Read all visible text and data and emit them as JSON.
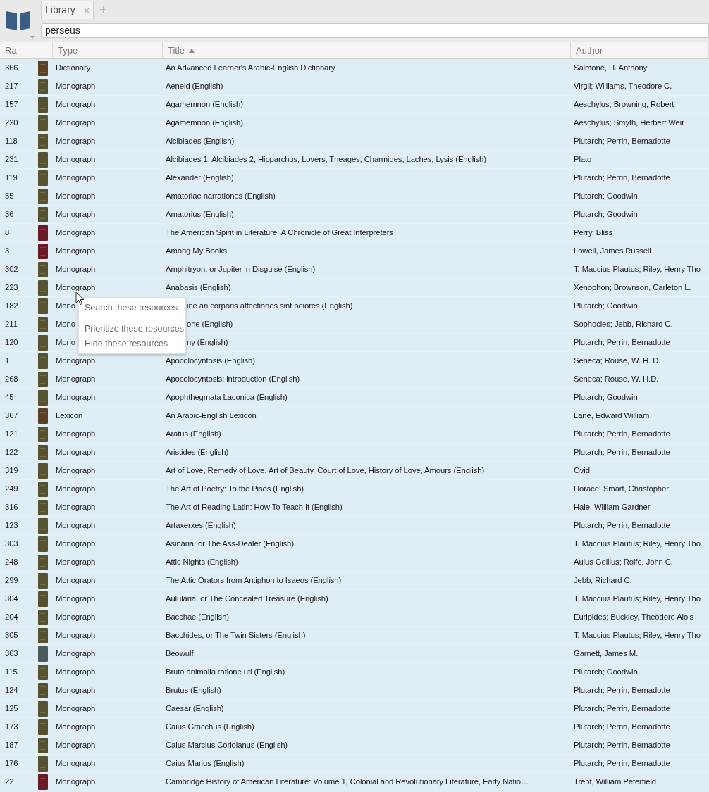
{
  "tabs": [
    {
      "label": "Library",
      "selected": true,
      "closable": true
    }
  ],
  "search": {
    "value": "perseus"
  },
  "columns": [
    {
      "label": "Ra",
      "sorted": false
    },
    {
      "sorted": false
    },
    {
      "label": "Type",
      "sorted": false
    },
    {
      "label": "Title",
      "sorted": true
    },
    {
      "label": "Author",
      "sorted": false
    }
  ],
  "rows": [
    {
      "rank": "366",
      "color": "#5a4126",
      "type": "Dictionary",
      "title": "An Advanced Learner's Arabic-English Dictionary",
      "author": "Salmoné, H. Anthony",
      "covered": false
    },
    {
      "rank": "217",
      "color": "#57522f",
      "type": "Monograph",
      "title": "Aeneid (English)",
      "author": "Virgil; Williams, Theodore C.",
      "covered": false
    },
    {
      "rank": "157",
      "color": "#57522f",
      "type": "Monograph",
      "title": "Agamemnon (English)",
      "author": "Aeschylus; Browning, Robert",
      "covered": false
    },
    {
      "rank": "220",
      "color": "#57522f",
      "type": "Monograph",
      "title": "Agamemnon (English)",
      "author": "Aeschylus; Smyth, Herbert Weir",
      "covered": false
    },
    {
      "rank": "118",
      "color": "#57522f",
      "type": "Monograph",
      "title": "Alcibiades (English)",
      "author": "Plutarch; Perrin, Bernadotte",
      "covered": false
    },
    {
      "rank": "231",
      "color": "#57522f",
      "type": "Monograph",
      "title": "Alcibiades 1, Alcibiades 2, Hipparchus, Lovers, Theages, Charmides, Laches, Lysis (English)",
      "author": "Plato",
      "covered": false
    },
    {
      "rank": "119",
      "color": "#57522f",
      "type": "Monograph",
      "title": "Alexander (English)",
      "author": "Plutarch; Perrin, Bernadotte",
      "covered": false
    },
    {
      "rank": "55",
      "color": "#57522f",
      "type": "Monograph",
      "title": "Amatoriae narrationes (English)",
      "author": "Plutarch; Goodwin",
      "covered": false
    },
    {
      "rank": "36",
      "color": "#57522f",
      "type": "Monograph",
      "title": "Amatorius (English)",
      "author": "Plutarch; Goodwin",
      "covered": false
    },
    {
      "rank": "8",
      "color": "#6b1b25",
      "type": "Monograph",
      "title": "The American Spirit in Literature: A Chronicle of Great Interpreters",
      "author": "Perry, Bliss",
      "covered": false
    },
    {
      "rank": "3",
      "color": "#6b1b25",
      "type": "Monograph",
      "title": "Among My Books",
      "author": "Lowell, James Russell",
      "covered": false
    },
    {
      "rank": "302",
      "color": "#57522f",
      "type": "Monograph",
      "title": "Amphitryon, or Jupiter in Disguise (English)",
      "author": "T. Maccius Plautus; Riley, Henry Tho",
      "covered": false
    },
    {
      "rank": "223",
      "color": "#57522f",
      "type": "Monograph",
      "title": "Anabasis (English)",
      "author": "Xenophon; Brownson, Carleton L.",
      "covered": false
    },
    {
      "rank": "182",
      "color": "#57522f",
      "type": "Mono",
      "title": "ine an corporis affectiones sint peiores (English)",
      "author": "Plutarch; Goodwin",
      "covered": true
    },
    {
      "rank": "211",
      "color": "#57522f",
      "type": "Mono",
      "title": "one (English)",
      "author": "Sophocles; Jebb, Richard C.",
      "covered": true
    },
    {
      "rank": "120",
      "color": "#57522f",
      "type": "Mono",
      "title": "ny (English)",
      "author": "Plutarch; Perrin, Bernadotte",
      "covered": true
    },
    {
      "rank": "1",
      "color": "#57522f",
      "type": "Monograph",
      "title": "Apocolocyntosis (English)",
      "author": "Seneca; Rouse, W. H. D.",
      "covered": false
    },
    {
      "rank": "268",
      "color": "#57522f",
      "type": "Monograph",
      "title": "Apocolocyntosis: introduction (English)",
      "author": "Seneca; Rouse, W. H.D.",
      "covered": false
    },
    {
      "rank": "45",
      "color": "#57522f",
      "type": "Monograph",
      "title": "Apophthegmata Laconica (English)",
      "author": "Plutarch; Goodwin",
      "covered": false
    },
    {
      "rank": "367",
      "color": "#5a4126",
      "type": "Lexicon",
      "title": "An Arabic-English Lexicon",
      "author": "Lane, Edward William",
      "covered": false
    },
    {
      "rank": "121",
      "color": "#57522f",
      "type": "Monograph",
      "title": "Aratus (English)",
      "author": "Plutarch; Perrin, Bernadotte",
      "covered": false
    },
    {
      "rank": "122",
      "color": "#57522f",
      "type": "Monograph",
      "title": "Aristides (English)",
      "author": "Plutarch; Perrin, Bernadotte",
      "covered": false
    },
    {
      "rank": "319",
      "color": "#57522f",
      "type": "Monograph",
      "title": "Art of Love, Remedy of Love, Art of Beauty, Court of Love, History of Love, Amours (English)",
      "author": "Ovid",
      "covered": false
    },
    {
      "rank": "249",
      "color": "#57522f",
      "type": "Monograph",
      "title": "The Art of Poetry: To the Pisos (English)",
      "author": "Horace; Smart, Christopher",
      "covered": false
    },
    {
      "rank": "316",
      "color": "#57522f",
      "type": "Monograph",
      "title": "The Art of Reading Latin: How To Teach It (English)",
      "author": "Hale, William Gardner",
      "covered": false
    },
    {
      "rank": "123",
      "color": "#57522f",
      "type": "Monograph",
      "title": "Artaxerxes (English)",
      "author": "Plutarch; Perrin, Bernadotte",
      "covered": false
    },
    {
      "rank": "303",
      "color": "#57522f",
      "type": "Monograph",
      "title": "Asinaria, or The Ass-Dealer (English)",
      "author": "T. Maccius Plautus; Riley, Henry Tho",
      "covered": false
    },
    {
      "rank": "248",
      "color": "#57522f",
      "type": "Monograph",
      "title": "Attic Nights (English)",
      "author": "Aulus Gellius; Rolfe, John C.",
      "covered": false
    },
    {
      "rank": "299",
      "color": "#57522f",
      "type": "Monograph",
      "title": "The Attic Orators from Antiphon to Isaeos (English)",
      "author": "Jebb, Richard C.",
      "covered": false
    },
    {
      "rank": "304",
      "color": "#57522f",
      "type": "Monograph",
      "title": "Aulularia, or The Concealed Treasure (English)",
      "author": "T. Maccius Plautus; Riley, Henry Tho",
      "covered": false
    },
    {
      "rank": "204",
      "color": "#57522f",
      "type": "Monograph",
      "title": "Bacchae (English)",
      "author": "Euripides; Buckley, Theodore Alois",
      "covered": false
    },
    {
      "rank": "305",
      "color": "#57522f",
      "type": "Monograph",
      "title": "Bacchides, or The Twin Sisters (English)",
      "author": "T. Maccius Plautus; Riley, Henry Tho",
      "covered": false
    },
    {
      "rank": "363",
      "color": "#4c5a5c",
      "type": "Monograph",
      "title": "Beowulf",
      "author": "Garnett, James M.",
      "covered": false
    },
    {
      "rank": "115",
      "color": "#57522f",
      "type": "Monograph",
      "title": "Bruta animalia ratione uti (English)",
      "author": "Plutarch; Goodwin",
      "covered": false
    },
    {
      "rank": "124",
      "color": "#57522f",
      "type": "Monograph",
      "title": "Brutus (English)",
      "author": "Plutarch; Perrin, Bernadotte",
      "covered": false
    },
    {
      "rank": "125",
      "color": "#57522f",
      "type": "Monograph",
      "title": "Caesar (English)",
      "author": "Plutarch; Perrin, Bernadotte",
      "covered": false
    },
    {
      "rank": "173",
      "color": "#57522f",
      "type": "Monograph",
      "title": "Caius Gracchus (English)",
      "author": "Plutarch; Perrin, Bernadotte",
      "covered": false
    },
    {
      "rank": "187",
      "color": "#57522f",
      "type": "Monograph",
      "title": "Caius Marcius Coriolanus (English)",
      "author": "Plutarch; Perrin, Bernadotte",
      "covered": false
    },
    {
      "rank": "176",
      "color": "#57522f",
      "type": "Monograph",
      "title": "Caius Marius (English)",
      "author": "Plutarch; Perrin, Bernadotte",
      "covered": false
    },
    {
      "rank": "22",
      "color": "#6b1b25",
      "type": "Monograph",
      "title": "Cambridge History of American Literature: Volume 1, Colonial and Revolutionary Literature, Early Natio…",
      "author": "Trent, William Peterfield",
      "covered": false
    }
  ],
  "context_menu": {
    "items": [
      {
        "label": "Search these resources",
        "separator_after": true
      },
      {
        "label": "Prioritize these resources",
        "separator_after": false
      },
      {
        "label": "Hide these resources",
        "separator_after": false
      }
    ]
  }
}
